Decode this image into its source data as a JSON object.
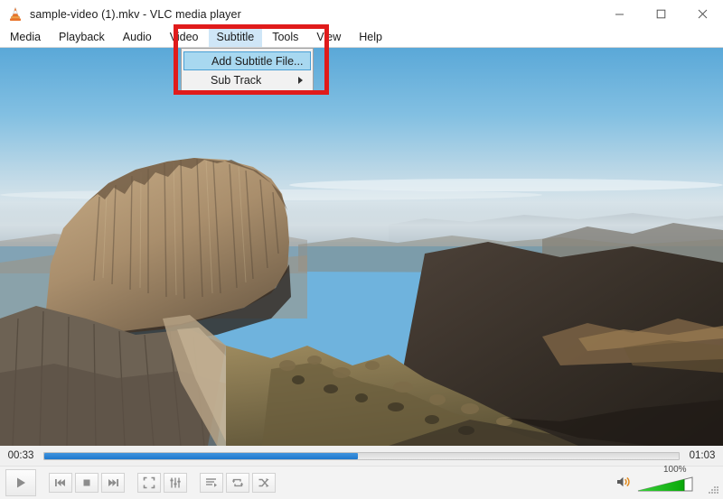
{
  "window": {
    "title": "sample-video (1).mkv - VLC media player",
    "app_icon": "vlc-cone-icon",
    "controls": [
      {
        "name": "minimize-button",
        "glyph": "minimize-icon"
      },
      {
        "name": "maximize-button",
        "glyph": "maximize-icon"
      },
      {
        "name": "close-button",
        "glyph": "close-icon"
      }
    ]
  },
  "menubar": {
    "items": [
      {
        "label": "Media",
        "active": false
      },
      {
        "label": "Playback",
        "active": false
      },
      {
        "label": "Audio",
        "active": false
      },
      {
        "label": "Video",
        "active": false
      },
      {
        "label": "Subtitle",
        "active": true
      },
      {
        "label": "Tools",
        "active": false
      },
      {
        "label": "View",
        "active": false
      },
      {
        "label": "Help",
        "active": false
      }
    ]
  },
  "dropdown": {
    "parent": "Subtitle",
    "items": [
      {
        "label": "Add Subtitle File...",
        "selected": true,
        "submenu": false
      },
      {
        "label": "Sub Track",
        "selected": false,
        "submenu": true
      }
    ]
  },
  "annotation": {
    "shape": "rectangle",
    "color": "#e01b1b",
    "highlights": "Subtitle menu and its dropdown"
  },
  "playback": {
    "elapsed": "00:33",
    "remaining": "01:03",
    "progress_percent": 49.5,
    "accent_color": "#2079ce"
  },
  "controls": {
    "play_button": "play-icon",
    "previous_button": "previous-icon",
    "stop_button": "stop-icon",
    "next_button": "next-icon",
    "fullscreen_button": "fullscreen-icon",
    "extended_settings_button": "equalizer-icon",
    "playlist_button": "playlist-icon",
    "loop_button": "loop-icon",
    "random_button": "shuffle-icon",
    "mute_button": "speaker-icon",
    "resize_grip": "resize-grip-icon"
  },
  "volume": {
    "label": "100%",
    "value": 100,
    "color": "#25bb25"
  },
  "video_frame": {
    "description": "Aerial view of a sunlit rocky mountain summit with hazy blue sky and distant ridges",
    "sky_top_color": "#69b1dc",
    "sky_horizon_color": "#cfe0ea",
    "rock_sunlit_color": "#ab9171",
    "rock_shadow_color": "#3a3027"
  }
}
